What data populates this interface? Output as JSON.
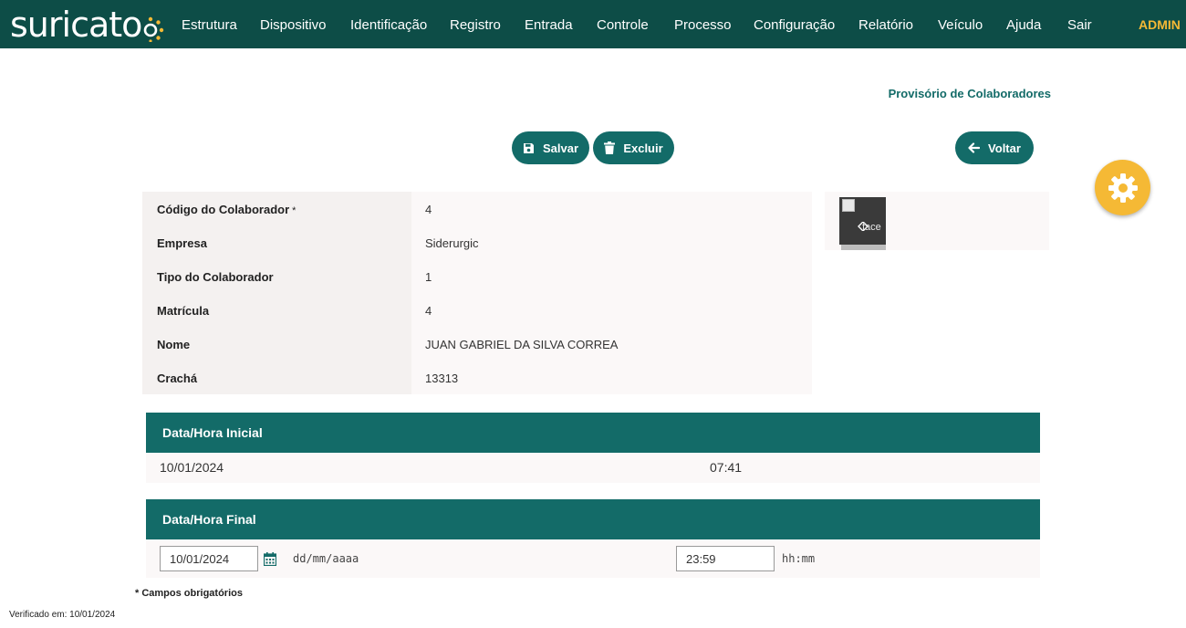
{
  "brand": {
    "name": "suricato",
    "colors": {
      "nav": "#0d4d47",
      "primary": "#136b68",
      "accent": "#f5b935"
    }
  },
  "nav": {
    "items": [
      {
        "label": "Estrutura"
      },
      {
        "label": "Dispositivo"
      },
      {
        "label": "Identificação"
      },
      {
        "label": "Registro"
      },
      {
        "label": "Entrada"
      },
      {
        "label": "Controle"
      },
      {
        "label": "Processo"
      },
      {
        "label": "Configuração"
      },
      {
        "label": "Relatório"
      },
      {
        "label": "Veículo"
      },
      {
        "label": "Ajuda"
      },
      {
        "label": "Sair"
      }
    ],
    "user": "ADMIN"
  },
  "page": {
    "title": "Provisório de Colaboradores"
  },
  "toolbar": {
    "save_label": "Salvar",
    "save_icon": "floppy-disk-icon",
    "delete_label": "Excluir",
    "delete_icon": "trash-icon",
    "back_label": "Voltar",
    "back_icon": "arrow-left-icon"
  },
  "settings": {
    "icon": "gear-icon"
  },
  "info": {
    "rows": [
      {
        "label": "Código do Colaborador",
        "required_mark": "*",
        "value": "4"
      },
      {
        "label": "Empresa",
        "value": "Siderurgic"
      },
      {
        "label": "Tipo do Colaborador",
        "value": "1"
      },
      {
        "label": "Matrícula",
        "value": "4"
      },
      {
        "label": "Nome",
        "value": "JUAN GABRIEL DA SILVA CORREA"
      },
      {
        "label": "Crachá",
        "value": "13313"
      }
    ]
  },
  "photo": {
    "alt": "face"
  },
  "start": {
    "heading": "Data/Hora Inicial",
    "date": "10/01/2024",
    "time": "07:41"
  },
  "end": {
    "heading": "Data/Hora Final",
    "date": "10/01/2024",
    "date_hint": "dd/mm/aaaa",
    "date_icon": "calendar-icon",
    "time": "23:59",
    "time_hint": "hh:mm"
  },
  "notes": {
    "required": "* Campos obrigatórios",
    "verified": "Verificado em: 10/01/2024"
  }
}
